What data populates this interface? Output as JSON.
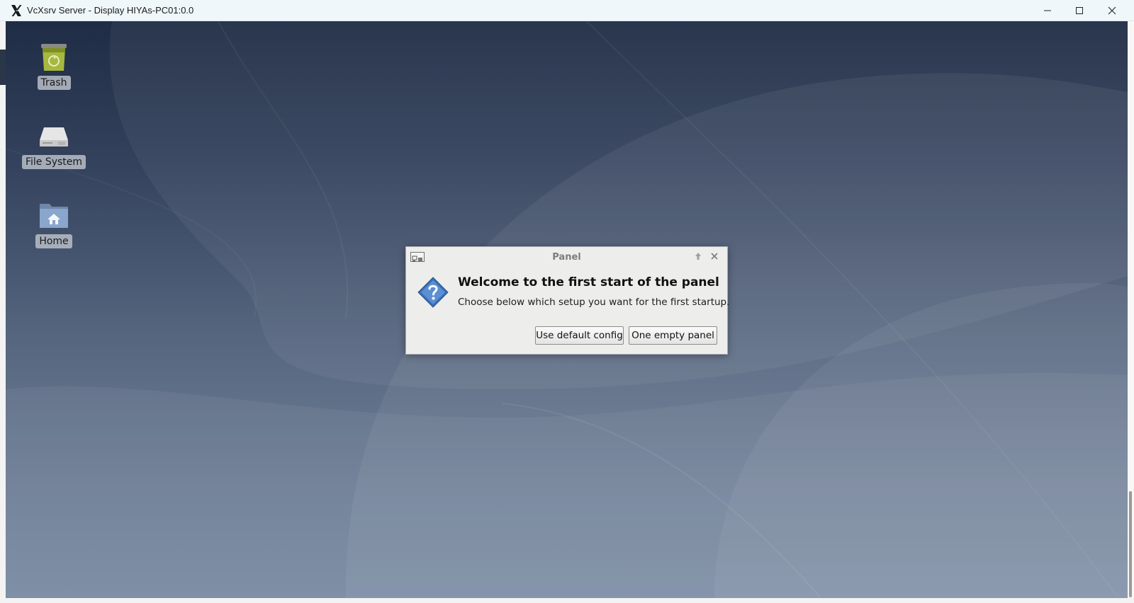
{
  "window": {
    "title": "VcXsrv Server - Display HIYAs-PC01:0.0",
    "controls": [
      "minimize-icon",
      "maximize-icon",
      "close-icon"
    ]
  },
  "desktop": {
    "icons": [
      {
        "label": "Trash",
        "icon": "trash-icon"
      },
      {
        "label": "File System",
        "icon": "drive-icon"
      },
      {
        "label": "Home",
        "icon": "home-folder-icon"
      }
    ]
  },
  "dialog": {
    "title": "Panel",
    "heading": "Welcome to the first start of the panel",
    "message": "Choose below which setup you want for the first startup.",
    "buttons": {
      "default_config": "Use default config",
      "empty_panel": "One empty panel"
    },
    "icon": "question-icon"
  },
  "colors": {
    "desktop_top": "#1f2c45",
    "desktop_bottom": "#788aa2",
    "dialog_bg": "#ededeb",
    "question_blue": "#3a6db3"
  }
}
